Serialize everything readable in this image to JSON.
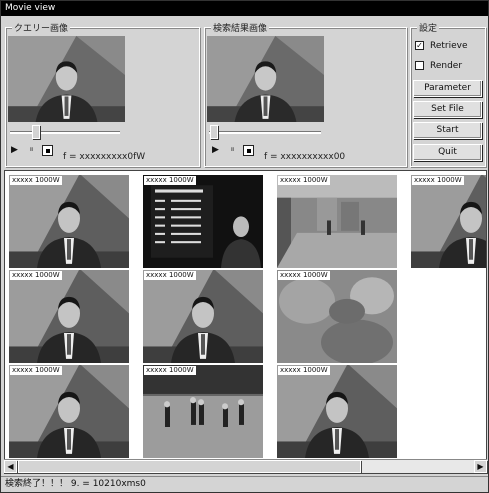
{
  "window": {
    "title": "Movie view"
  },
  "query_panel": {
    "label": "クエリー画像",
    "frame_value": "f = xxxxxxxxx0fW",
    "controls": {
      "play": "▶",
      "pause": "⏸"
    }
  },
  "result_panel": {
    "label": "検索結果画像",
    "frame_value": "f = xxxxxxxxxx00",
    "controls": {
      "play": "▶",
      "pause": "⏸"
    }
  },
  "settings": {
    "label": "設定",
    "checkboxes": [
      {
        "label": "Retrieve",
        "checked": true
      },
      {
        "label": "Render",
        "checked": false
      }
    ],
    "buttons": {
      "parameter": "Parameter",
      "set_file": "Set File",
      "start": "Start",
      "quit": "Quit"
    }
  },
  "thumbnails": [
    {
      "label": "xxxxx 1000W",
      "scene": "anchor"
    },
    {
      "label": "xxxxx 1000W",
      "scene": "scoreboard"
    },
    {
      "label": "xxxxx 1000W",
      "scene": "hall"
    },
    {
      "label": "xxxxx 1000W",
      "scene": "anchor"
    },
    {
      "label": "xxxxx 1000W",
      "scene": "anchor"
    },
    {
      "label": "xxxxx 1000W",
      "scene": "anchor"
    },
    {
      "label": "xxxxx 1000W",
      "scene": "blur"
    },
    {
      "label": "xxxxx 1000W",
      "scene": "anchor"
    },
    {
      "label": "xxxxx 1000W",
      "scene": "dance"
    },
    {
      "label": "xxxxx 1000W",
      "scene": "anchor"
    }
  ],
  "scrollbar": {
    "left_arrow": "◀",
    "right_arrow": "▶"
  },
  "status": {
    "text": "検索終了！！！ 9. = 10210xms0"
  }
}
